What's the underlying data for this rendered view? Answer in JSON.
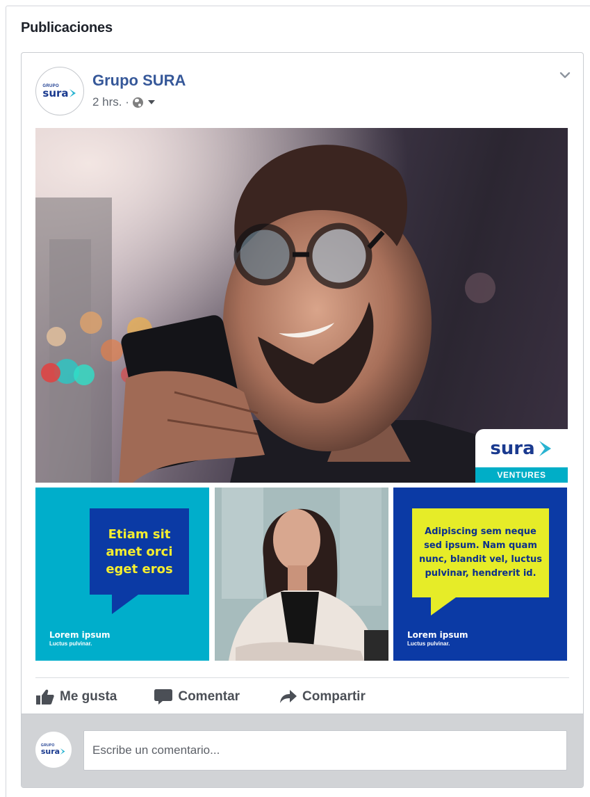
{
  "section": {
    "title": "Publicaciones"
  },
  "post": {
    "page_name": "Grupo SURA",
    "time": "2 hrs. ·",
    "avatar": {
      "brand_small": "GRUPO",
      "brand_word": "sura"
    },
    "main_image": {
      "badge_word": "sura",
      "badge_label": "VENTURES"
    },
    "thumbs": [
      {
        "bubble": [
          "Etiam sit",
          "amet orci",
          "eget eros"
        ],
        "title": "Lorem ipsum",
        "subtitle": "Luctus pulvinar."
      },
      {
        "kind": "photo"
      },
      {
        "bubble": [
          "Adipiscing sem neque",
          "sed ipsum. Nam quam",
          "nunc, blandit vel, luctus",
          "pulvinar, hendrerit id."
        ],
        "title": "Lorem ipsum",
        "subtitle": "Luctus pulvinar."
      }
    ]
  },
  "actions": {
    "like": "Me gusta",
    "comment": "Comentar",
    "share": "Compartir"
  },
  "comment": {
    "placeholder": "Escribe un comentario..."
  },
  "colors": {
    "link": "#365899",
    "sura_blue": "#1a3a8f",
    "cyan": "#00aecb",
    "royal": "#0b3aa5",
    "yellow": "#e6ec28"
  },
  "icons": [
    "chevron-down-icon",
    "globe-icon",
    "thumbs-up-icon",
    "speech-bubble-icon",
    "share-arrow-icon"
  ]
}
